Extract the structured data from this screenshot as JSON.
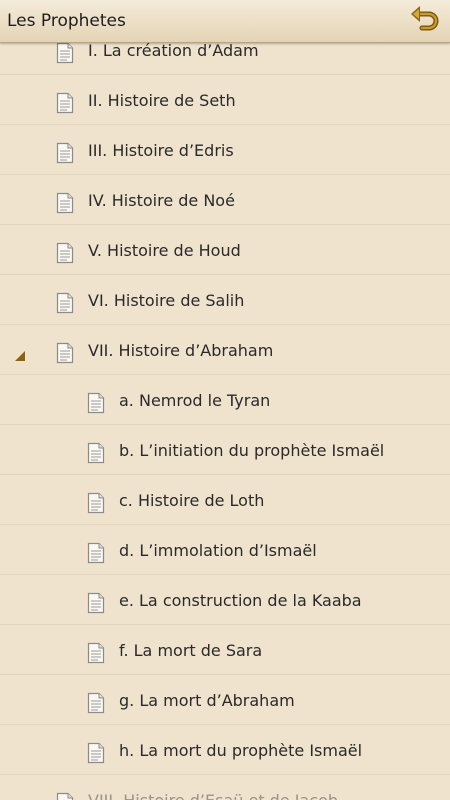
{
  "app": {
    "title": "Les Prophetes"
  },
  "items": [
    {
      "label": "I. La création d’Adam",
      "level": 0
    },
    {
      "label": "II. Histoire de Seth",
      "level": 0
    },
    {
      "label": "III. Histoire d’Edris",
      "level": 0
    },
    {
      "label": "IV. Histoire de Noé",
      "level": 0
    },
    {
      "label": "V. Histoire de Houd",
      "level": 0
    },
    {
      "label": "VI. Histoire de Salih",
      "level": 0
    },
    {
      "label": "VII. Histoire d’Abraham",
      "level": 0,
      "expanded": true
    },
    {
      "label": "a. Nemrod le Tyran",
      "level": 1
    },
    {
      "label": "b. L’initiation du prophète Ismaël",
      "level": 1
    },
    {
      "label": "c. Histoire de Loth",
      "level": 1
    },
    {
      "label": "d. L’immolation d’Ismaël",
      "level": 1
    },
    {
      "label": "e. La construction de la Kaaba",
      "level": 1
    },
    {
      "label": "f. La mort de Sara",
      "level": 1
    },
    {
      "label": "g. La mort d’Abraham",
      "level": 1
    },
    {
      "label": "h. La mort du prophète Ismaël",
      "level": 1
    },
    {
      "label": "VIII. Histoire d’Esaü et de Jacob",
      "level": 0
    }
  ],
  "icons": {
    "back": "back-arrow-icon",
    "document": "document-icon",
    "expander": "expanded-triangle-icon"
  },
  "colors": {
    "background": "#efe3ce",
    "accent": "#b07a10"
  }
}
